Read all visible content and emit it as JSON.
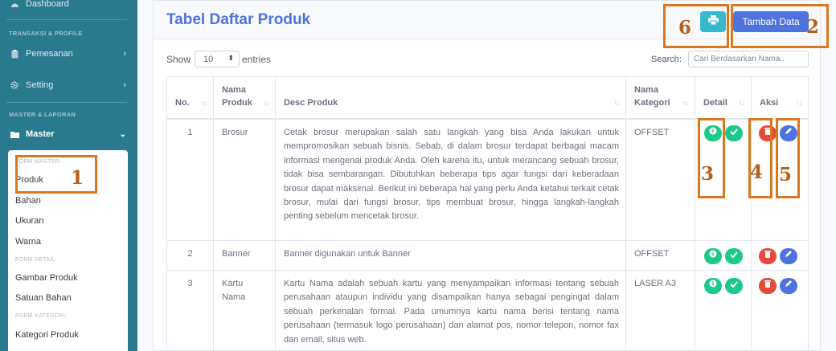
{
  "sidebar": {
    "dashboard": "Dashboard",
    "heading_transaksi": "TRANSAKSI & PROFILE",
    "pemesanan": "Pemesanan",
    "setting": "Setting",
    "heading_master": "MASTER & LAPORAN",
    "master": "Master",
    "submenu": {
      "form_master": "FORM MASTER:",
      "produk": "Produk",
      "bahan": "Bahan",
      "ukuran": "Ukuran",
      "warna": "Warna",
      "form_detail": "FORM DETAIL:",
      "gambar_produk": "Gambar Produk",
      "satuan_bahan": "Satuan Bahan",
      "form_kategori": "FORM KATEGORI:",
      "kategori_produk": "Kategori Produk"
    }
  },
  "header": {
    "title": "Tabel Daftar Produk",
    "add_button": "Tambah Data"
  },
  "controls": {
    "show_label": "Show",
    "entries_value": "10",
    "entries_label": "entries",
    "search_label": "Search:",
    "search_placeholder": "Cari Berdasarkan Nama.."
  },
  "table": {
    "columns": [
      "No.",
      "Nama Produk",
      "Desc Produk",
      "Nama Kategori",
      "Detail",
      "Aksi"
    ],
    "rows": [
      {
        "no": "1",
        "nama": "Brosur",
        "desc": "Cetak brosur merupakan salah satu langkah yang bisa Anda lakukan untuk mempromosikan sebuah bisnis. Sebab, di dalam brosur terdapat berbagai macam informasi mengenai produk Anda. Oleh karena itu, untuk merancang sebuah brosur, tidak bisa sembarangan. Dibutuhkan beberapa tips agar fungsi dari keberadaan brosur dapat maksimal. Berikut ini beberapa hal yang perlu Anda ketahui terkait cetak brosur, mulai dari fungsi brosur, tips membuat brosur, hingga langkah-langkah penting sebelum mencetak brosur.",
        "kategori": "OFFSET"
      },
      {
        "no": "2",
        "nama": "Banner",
        "desc": "Banner digunakan untuk Banner",
        "kategori": "OFFSET"
      },
      {
        "no": "3",
        "nama": "Kartu Nama",
        "desc": "Kartu Nama adalah sebuah kartu yang menyampaikan informasi tentang sebuah perusahaan ataupun individu yang disampaikan hanya sebagai pengingat dalam sebuah perkenalan formal. Pada umumnya kartu nama berisi tentang nama perusahaan (termasuk logo perusahaan) dan alamat pos, nomor telepon, nomor fax dan email, situs web.",
        "kategori": "LASER A3"
      }
    ]
  },
  "annotations": [
    "1",
    "2",
    "3",
    "4",
    "5",
    "6"
  ],
  "colors": {
    "sidebar": "#2a7a8f",
    "primary": "#4e73df",
    "info": "#36b9cc",
    "success": "#1cc88a",
    "danger": "#e74a3b",
    "annotation": "#d9781f"
  }
}
